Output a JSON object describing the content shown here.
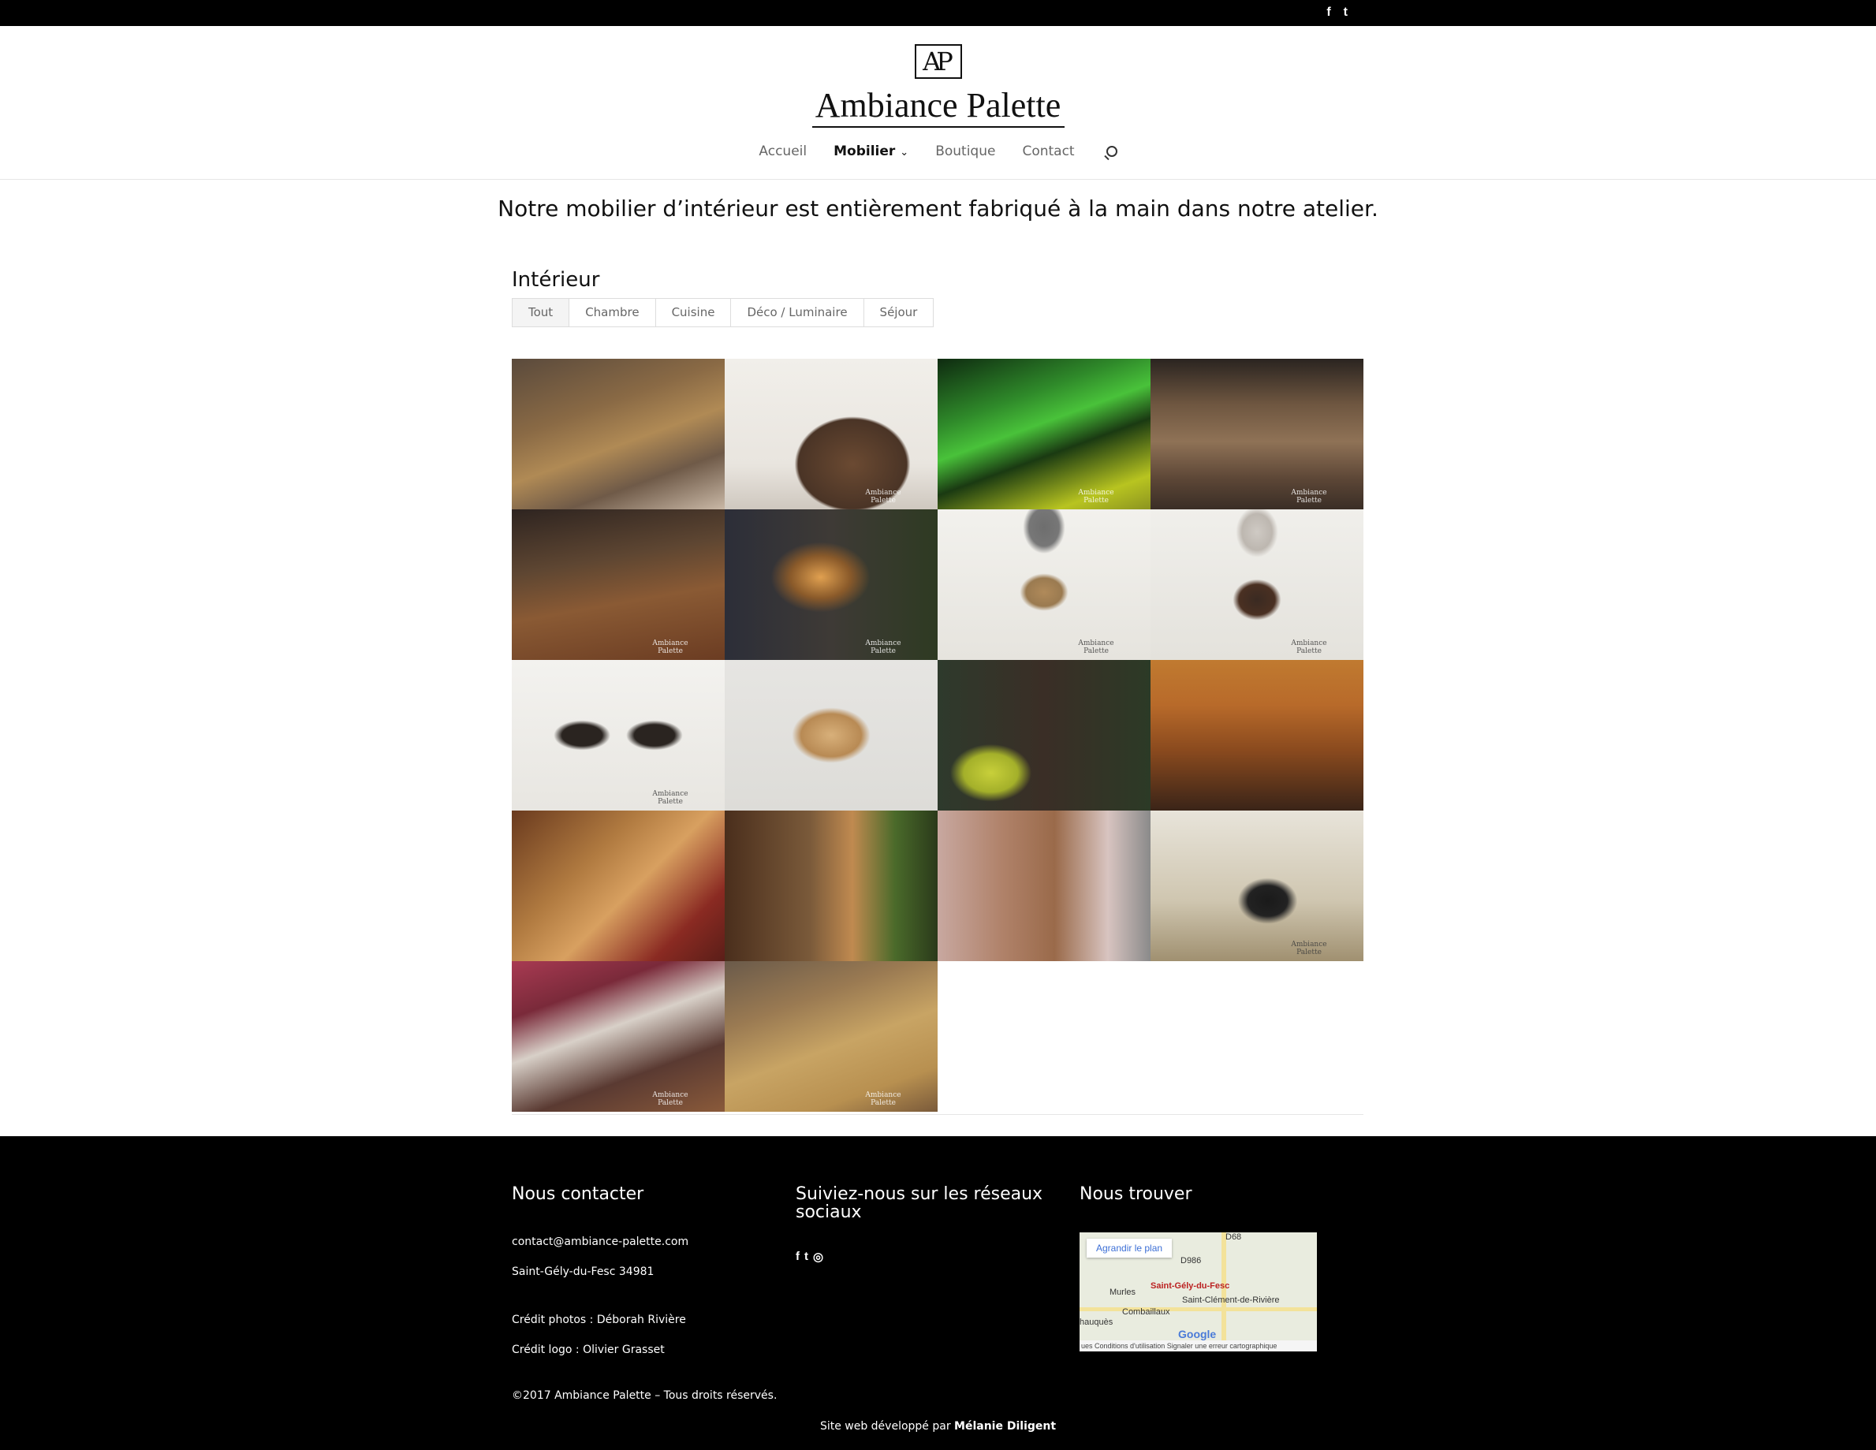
{
  "topbar": {
    "social_icons": [
      "facebook-icon",
      "twitter-icon"
    ],
    "facebook_glyph": "f",
    "twitter_glyph": "t"
  },
  "logo": {
    "mark": "AP",
    "text": "Ambiance Palette"
  },
  "nav": {
    "items": [
      "Accueil",
      "Mobilier",
      "Boutique",
      "Contact"
    ],
    "active": "Mobilier",
    "chevron": "⌄"
  },
  "tagline": "Notre mobilier d’intérieur est entièrement fabriqué à la main dans notre atelier.",
  "section_title": "Intérieur",
  "filters": [
    "Tout",
    "Chambre",
    "Cuisine",
    "Déco / Luminaire",
    "Séjour"
  ],
  "active_filter": "Tout",
  "gallery": {
    "watermark": "Ambiance Palette",
    "items": [
      "table-bar-photo",
      "commode-photo",
      "banc-lumineux-photo",
      "meuble-tv-photo",
      "desserte-photo",
      "lampe-zigzag-photo",
      "lampe-cubes-photo",
      "lampe-cubes-2-photo",
      "lampes-duo-photo",
      "applique-photo",
      "lampe-colonne-photo",
      "etagere-epices-photo",
      "bureau-photo",
      "bibliotheque-photo",
      "etagere-murale-photo",
      "arbre-chat-photo",
      "lit-blanc-photo",
      "lit-naturel-photo"
    ]
  },
  "footer": {
    "contact_title": "Nous contacter",
    "email": "contact@ambiance-palette.com",
    "city": "Saint-Gély-du-Fesc 34981",
    "credit_photos": "Crédit photos : Déborah Rivière",
    "credit_logo": "Crédit logo : Olivier Grasset",
    "social_title": "Suiviez-nous sur les réseaux sociaux",
    "social_glyphs": [
      "f",
      "t",
      "◎"
    ],
    "find_title": "Nous trouver",
    "map": {
      "button": "Agrandir le plan",
      "labels": [
        "D68",
        "D986",
        "Murles",
        "Saint-Gély-du-Fesc",
        "Saint-Clément-de-Rivière",
        "Combaillaux",
        "hauquès"
      ],
      "google": "Google",
      "bottom": "ues    Conditions d'utilisation    Signaler une erreur cartographique"
    },
    "copyright": "©2017 Ambiance Palette – Tous droits réservés.",
    "dev_prefix": "Site web développé par",
    "dev_name": "Mélanie Diligent"
  }
}
